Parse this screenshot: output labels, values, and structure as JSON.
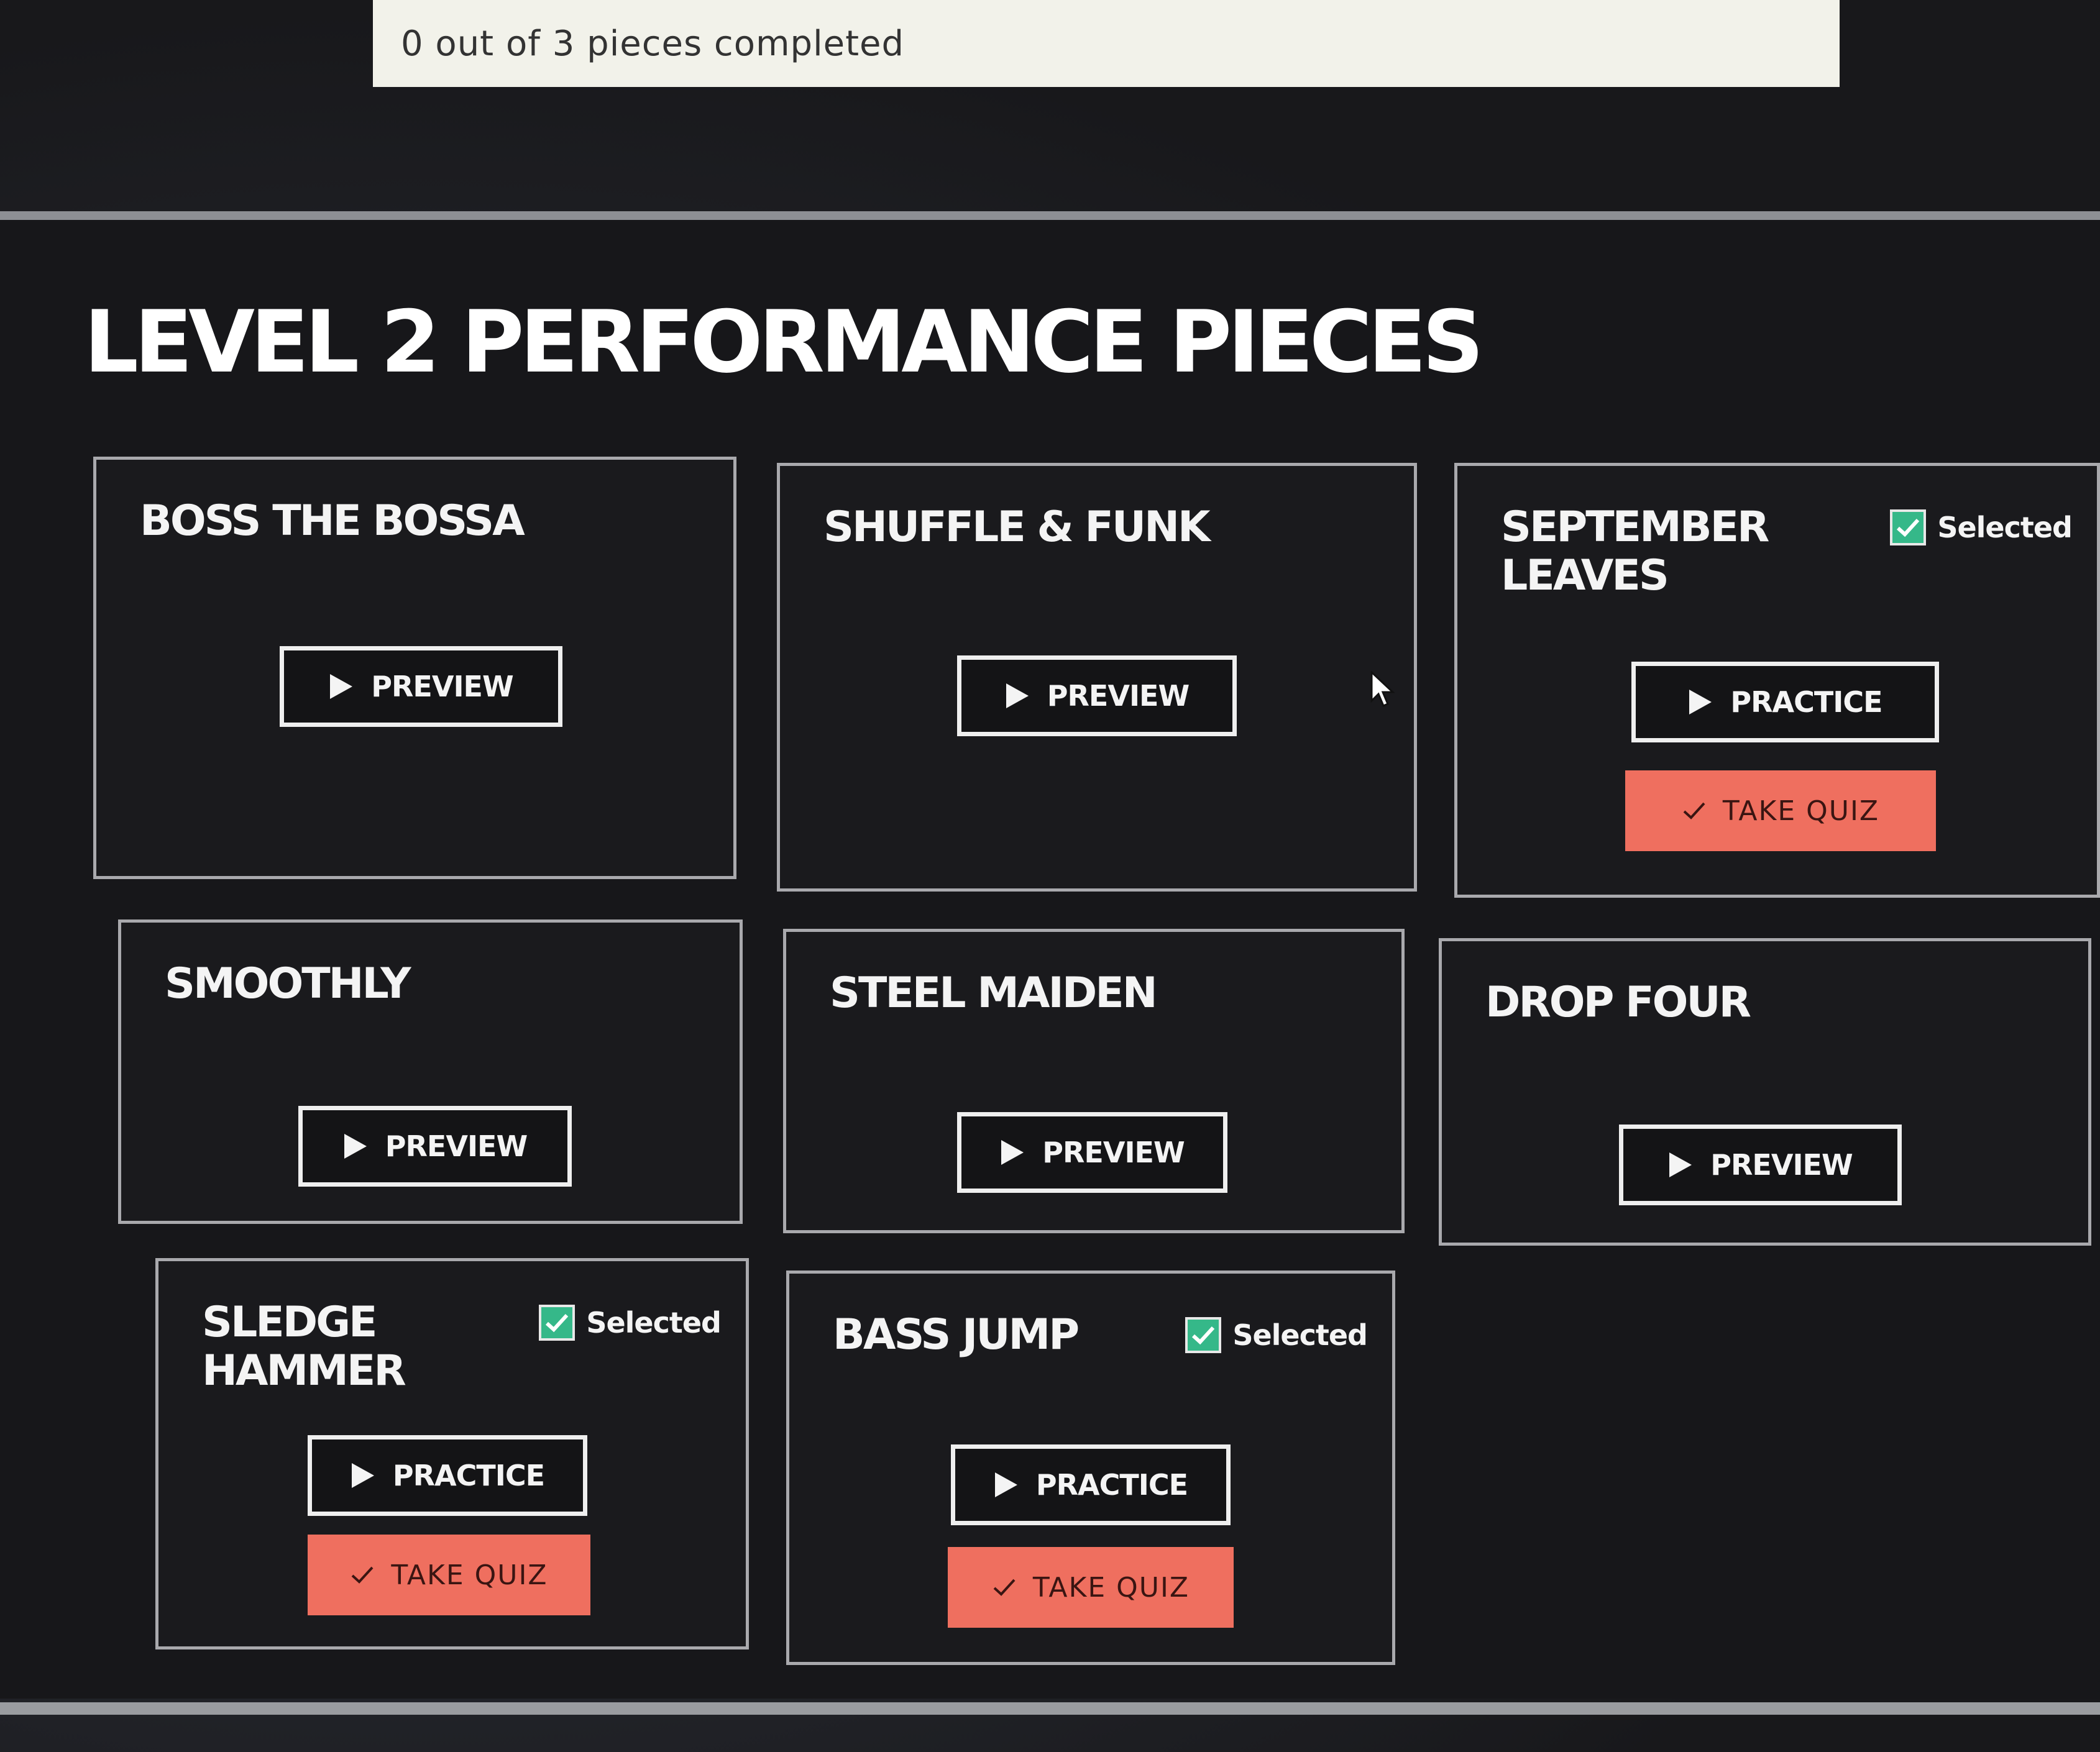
{
  "progress": {
    "text": "0 out of 3 pieces completed"
  },
  "page": {
    "title": "LEVEL 2 PERFORMANCE PIECES"
  },
  "labels": {
    "selected": "Selected",
    "preview": "PREVIEW",
    "practice": "PRACTICE",
    "take_quiz": "TAKE QUIZ"
  },
  "pieces": [
    {
      "title": "BOSS THE BOSSA",
      "selected": false
    },
    {
      "title": "SHUFFLE & FUNK",
      "selected": false
    },
    {
      "title": "SEPTEMBER LEAVES",
      "selected": true
    },
    {
      "title": "SMOOTHLY",
      "selected": false
    },
    {
      "title": "STEEL MAIDEN",
      "selected": false
    },
    {
      "title": "DROP FOUR",
      "selected": false
    },
    {
      "title": "SLEDGE HAMMER",
      "selected": true
    },
    {
      "title": "BASS JUMP",
      "selected": true
    }
  ],
  "colors": {
    "background": "#17171a",
    "card_border": "#a9a9ad",
    "checkbox": "#35b889",
    "quiz_button": "#ef6f5f",
    "progress_bg": "#f2f2ea"
  }
}
